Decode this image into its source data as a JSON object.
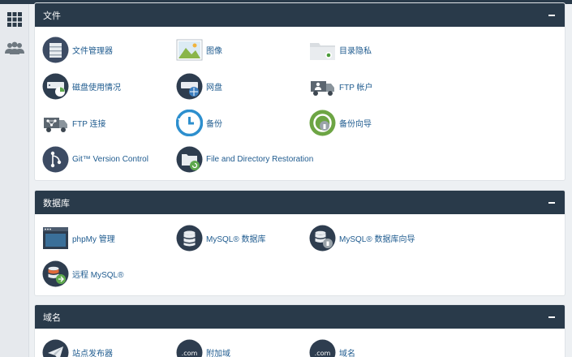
{
  "sidebar": {
    "items": [
      {
        "name": "apps-grid-icon"
      },
      {
        "name": "users-icon"
      }
    ]
  },
  "sections": {
    "files": {
      "title": "文件",
      "items": [
        {
          "label": "文件管理器",
          "icon": "file-manager-icon"
        },
        {
          "label": "图像",
          "icon": "images-icon"
        },
        {
          "label": "目录隐私",
          "icon": "directory-privacy-icon"
        },
        {
          "label": "磁盘使用情况",
          "icon": "disk-usage-icon"
        },
        {
          "label": "网盘",
          "icon": "web-disk-icon"
        },
        {
          "label": "FTP 帐户",
          "icon": "ftp-accounts-icon"
        },
        {
          "label": "FTP 连接",
          "icon": "ftp-connections-icon"
        },
        {
          "label": "备份",
          "icon": "backup-icon"
        },
        {
          "label": "备份向导",
          "icon": "backup-wizard-icon"
        },
        {
          "label": "Git™ Version Control",
          "icon": "git-icon"
        },
        {
          "label": "File and Directory Restoration",
          "icon": "file-restoration-icon"
        }
      ]
    },
    "databases": {
      "title": "数据库",
      "items": [
        {
          "label": "phpMy 管理",
          "icon": "phpmyadmin-icon"
        },
        {
          "label": "MySQL® 数据库",
          "icon": "mysql-databases-icon"
        },
        {
          "label": "MySQL® 数据库向导",
          "icon": "mysql-wizard-icon"
        },
        {
          "label": "远程 MySQL®",
          "icon": "remote-mysql-icon"
        }
      ]
    },
    "domains": {
      "title": "域名",
      "items": [
        {
          "label": "站点发布器",
          "icon": "site-publisher-icon"
        },
        {
          "label": "附加域",
          "icon": "addon-domains-icon"
        },
        {
          "label": "域名",
          "icon": "domains-icon"
        }
      ]
    }
  },
  "colors": {
    "header": "#293a4a",
    "link": "#1f5b8f",
    "background": "#edf0f3"
  }
}
